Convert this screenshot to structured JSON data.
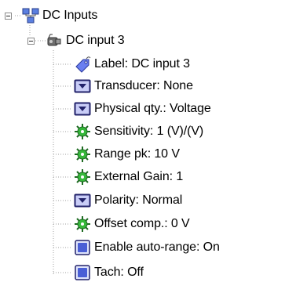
{
  "tree": {
    "root": {
      "label": "DC Inputs",
      "icon": "network-group-icon",
      "expanded": true
    },
    "channel": {
      "label": "DC input 3",
      "icon": "sensor-probe-icon",
      "expanded": true
    },
    "properties": [
      {
        "label": "Label: DC input 3",
        "icon": "tag-icon"
      },
      {
        "label": "Transducer: None",
        "icon": "dropdown-icon"
      },
      {
        "label": "Physical qty.: Voltage",
        "icon": "dropdown-icon"
      },
      {
        "label": "Sensitivity: 1 (V)/(V)",
        "icon": "gear-green-icon"
      },
      {
        "label": "Range pk: 10 V",
        "icon": "gear-green-icon"
      },
      {
        "label": "External Gain: 1",
        "icon": "gear-green-icon"
      },
      {
        "label": "Polarity: Normal",
        "icon": "dropdown-icon"
      },
      {
        "label": "Offset comp.: 0 V",
        "icon": "gear-green-icon"
      },
      {
        "label": "Enable auto-range: On",
        "icon": "checkbox-icon"
      },
      {
        "label": "Tach: Off",
        "icon": "checkbox-icon"
      }
    ]
  },
  "colors": {
    "tree_line": "#a0a0a0",
    "dropdown_frame": "#23236b",
    "dropdown_fill": "#c9cdf7",
    "gear_green": "#35b83a",
    "checkbox_blue": "#4a5fd6"
  }
}
